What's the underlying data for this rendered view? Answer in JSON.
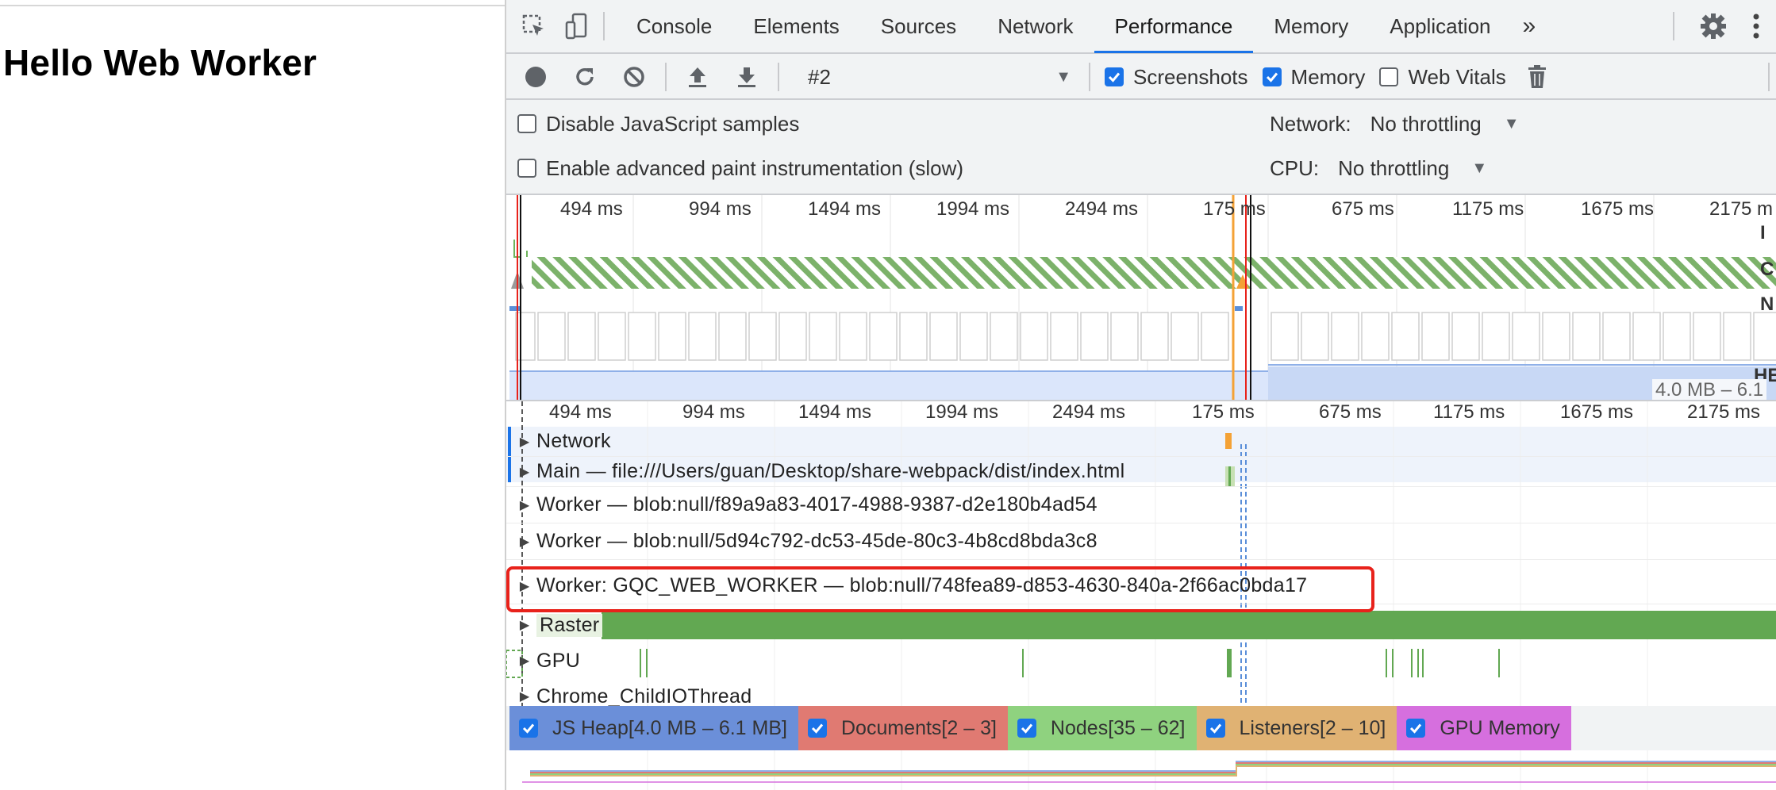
{
  "page": {
    "title": "Hello Web Worker"
  },
  "devtools": {
    "tabs": [
      "Console",
      "Elements",
      "Sources",
      "Network",
      "Performance",
      "Memory",
      "Application"
    ],
    "active_tab": "Performance",
    "more_tabs": "»",
    "icons": [
      "inspect-element-icon",
      "device-toolbar-icon",
      "settings-gear-icon",
      "kebab-menu-icon"
    ]
  },
  "toolbar": {
    "recording": "#2",
    "screenshots_label": "Screenshots",
    "screenshots_checked": true,
    "memory_label": "Memory",
    "memory_checked": true,
    "web_vitals_label": "Web Vitals",
    "web_vitals_checked": false,
    "icons": [
      "record-icon",
      "reload-icon",
      "clear-icon",
      "upload-icon",
      "download-icon",
      "trash-icon"
    ]
  },
  "settings": {
    "disable_js_samples": "Disable JavaScript samples",
    "enable_paint": "Enable advanced paint instrumentation (slow)",
    "network_label": "Network:",
    "network_value": "No throttling",
    "cpu_label": "CPU:",
    "cpu_value": "No throttling"
  },
  "overview": {
    "ticks": [
      "494 ms",
      "994 ms",
      "1494 ms",
      "1994 ms",
      "2494 ms",
      "175 ms",
      "675 ms",
      "1175 ms",
      "1675 ms",
      "2175 m"
    ],
    "heap_range": "4.0 MB – 6.1",
    "heap_label": "HE",
    "lane_labels": [
      "I",
      "C",
      "N"
    ]
  },
  "timeline": {
    "ticks": [
      "494 ms",
      "994 ms",
      "1494 ms",
      "1994 ms",
      "2494 ms",
      "175 ms",
      "675 ms",
      "1175 ms",
      "1675 ms",
      "2175 ms"
    ],
    "tracks": [
      "Network",
      "Main — file:///Users/guan/Desktop/share-webpack/dist/index.html",
      "Worker — blob:null/f89a9a83-4017-4988-9387-d2e180b4ad54",
      "Worker — blob:null/5d94c792-dc53-45de-80c3-4b8cd8bda3c8",
      "Worker: GQC_WEB_WORKER — blob:null/748fea89-d853-4630-840a-2f66ac0bda17",
      "Raster",
      "GPU",
      "Chrome_ChildIOThread"
    ]
  },
  "legend": [
    {
      "label": "JS Heap[4.0 MB – 6.1 MB]",
      "color": "#6b8fd9"
    },
    {
      "label": "Documents[2 – 3]",
      "color": "#e07a72"
    },
    {
      "label": "Nodes[35 – 62]",
      "color": "#8fd27f"
    },
    {
      "label": "Listeners[2 – 10]",
      "color": "#e0b273"
    },
    {
      "label": "GPU Memory",
      "color": "#d66fde"
    }
  ],
  "colors": {
    "accent": "#1a73e8",
    "highlight": "#e8221b",
    "raster_green": "#62a852",
    "hatch_green": "#7cb26a",
    "screenshot_orange": "#f4a236"
  }
}
